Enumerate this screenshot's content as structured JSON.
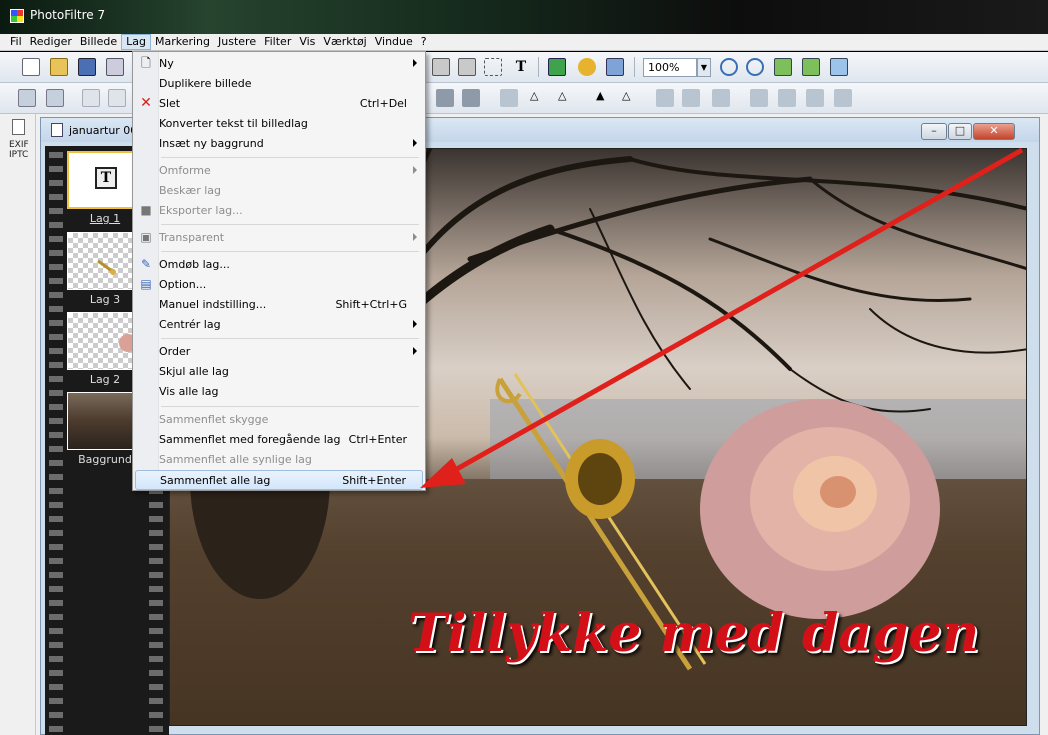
{
  "window": {
    "title": "PhotoFiltre 7"
  },
  "menubar": {
    "items": [
      "Fil",
      "Rediger",
      "Billede",
      "Lag",
      "Markering",
      "Justere",
      "Filter",
      "Vis",
      "Værktøj",
      "Vindue",
      "?"
    ],
    "open_menu": "Lag"
  },
  "toolbar": {
    "zoom_value": "100%"
  },
  "left_strip": {
    "exif_label_1": "EXIF",
    "exif_label_2": "IPTC"
  },
  "document": {
    "title": "januartur 003",
    "layers": [
      {
        "label": "Lag 1",
        "selected": true
      },
      {
        "label": "Lag 3",
        "selected": false
      },
      {
        "label": "Lag 2",
        "selected": false
      },
      {
        "label": "Baggrund",
        "selected": false
      }
    ],
    "caption": "Tillykke med dagen"
  },
  "lag_menu": {
    "items": [
      {
        "label": "Ny",
        "submenu": true,
        "icon": "new-page-icon"
      },
      {
        "label": "Duplikere billede"
      },
      {
        "label": "Slet",
        "shortcut": "Ctrl+Del",
        "icon": "delete-x-icon"
      },
      {
        "label": "Konverter tekst til billedlag"
      },
      {
        "label": "Insæt ny baggrund",
        "submenu": true
      },
      {
        "label": "Omforme",
        "submenu": true,
        "disabled": true
      },
      {
        "label": "Beskær lag",
        "disabled": true
      },
      {
        "label": "Eksporter lag...",
        "disabled": true,
        "icon": "save-disk-icon"
      },
      {
        "label": "Transparent",
        "submenu": true,
        "disabled": true,
        "icon": "transparent-icon"
      },
      {
        "label": "Omdøb lag...",
        "icon": "rename-icon"
      },
      {
        "label": "Option...",
        "icon": "options-icon"
      },
      {
        "label": "Manuel indstilling...",
        "shortcut": "Shift+Ctrl+G"
      },
      {
        "label": "Centrér lag",
        "submenu": true
      },
      {
        "label": "Order",
        "submenu": true
      },
      {
        "label": "Skjul alle lag"
      },
      {
        "label": "Vis alle lag"
      },
      {
        "label": "Sammenflet skygge",
        "disabled": true
      },
      {
        "label": "Sammenflet med foregående lag",
        "shortcut": "Ctrl+Enter"
      },
      {
        "label": "Sammenflet alle synlige lag",
        "disabled": true
      },
      {
        "label": "Sammenflet alle lag",
        "shortcut": "Shift+Enter",
        "highlighted": true
      }
    ]
  },
  "colors": {
    "highlight": "#d3e6fb",
    "arrow": "#e0201a",
    "caption": "#d31018"
  }
}
